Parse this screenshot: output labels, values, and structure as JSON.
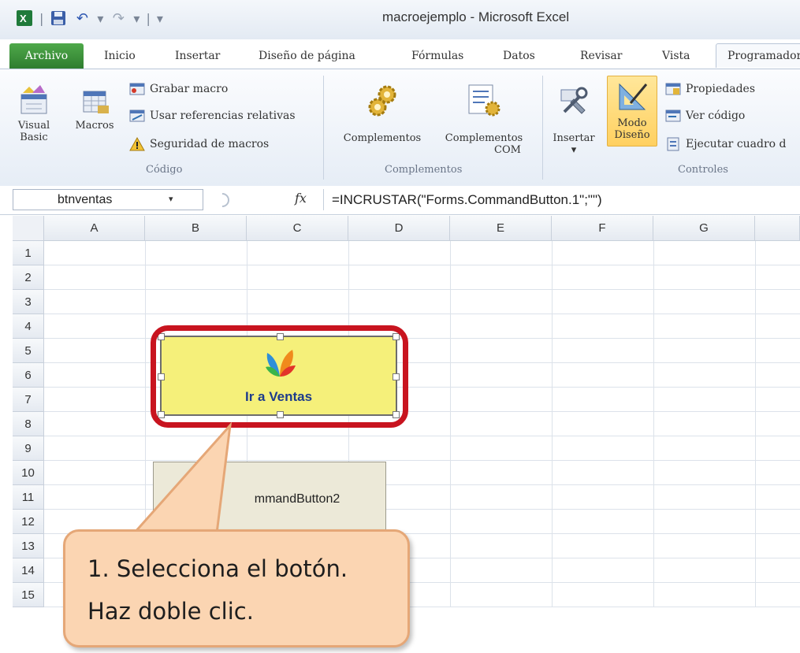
{
  "window": {
    "title": "macroejemplo  -  Microsoft Excel"
  },
  "qat": {
    "separator": "|",
    "dropdown_glyph": "▾",
    "undo_glyph": "↶",
    "redo_glyph": "↷"
  },
  "tabs": {
    "file": "Archivo",
    "items": [
      "Inicio",
      "Insertar",
      "Diseño de página",
      "Fórmulas",
      "Datos",
      "Revisar",
      "Vista"
    ],
    "active": "Programador"
  },
  "ribbon": {
    "codigo": {
      "label": "Código",
      "visual_basic": [
        "Visual",
        "Basic"
      ],
      "macros": "Macros",
      "grabar_macro": "Grabar macro",
      "usar_referencias": "Usar referencias relativas",
      "seguridad": "Seguridad de macros"
    },
    "complementos": {
      "label": "Complementos",
      "complementos": "Complementos",
      "complementos_com": [
        "Complementos",
        "COM"
      ]
    },
    "controles": {
      "label": "Controles",
      "insertar": "Insertar",
      "insertar_arrow": "▾",
      "modo_diseno": [
        "Modo",
        "Diseño"
      ],
      "propiedades": "Propiedades",
      "ver_codigo": "Ver código",
      "ejecutar_cuadro": "Ejecutar cuadro d"
    }
  },
  "formula_bar": {
    "name_box": "btnventas",
    "name_box_arrow": "▾",
    "fx": "fx",
    "formula": "=INCRUSTAR(\"Forms.CommandButton.1\";\"\")"
  },
  "grid": {
    "columns": [
      "A",
      "B",
      "C",
      "D",
      "E",
      "F",
      "G"
    ],
    "rows": [
      "1",
      "2",
      "3",
      "4",
      "5",
      "6",
      "7",
      "8",
      "9",
      "10",
      "11",
      "12",
      "13",
      "14",
      "15"
    ]
  },
  "embedded": {
    "ventas_button": "Ir a Ventas",
    "command_button2": "mmandButton2"
  },
  "callout": {
    "line1": "1. Selecciona el botón.",
    "line2": "Haz doble clic."
  },
  "colors": {
    "highlight_outline": "#c8141f",
    "ventas_bg": "#f5f07a",
    "callout_bg": "#fbd5b2",
    "file_tab": "#2f7d2f"
  }
}
